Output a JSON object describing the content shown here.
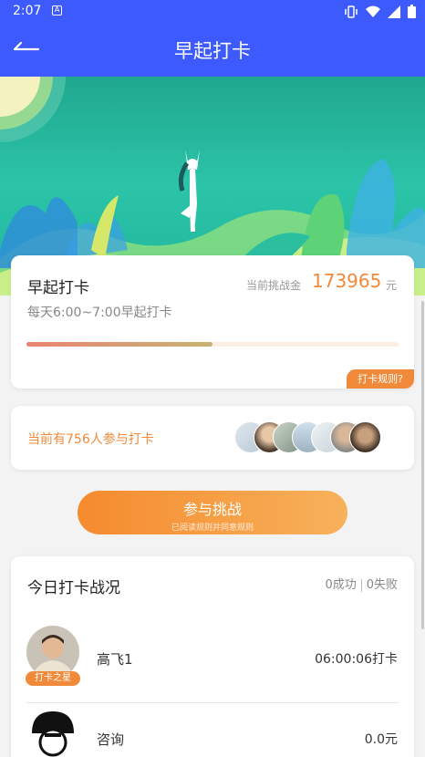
{
  "status_bar": {
    "time": "2:07",
    "icons": [
      "a-notification-icon",
      "vibrate-icon",
      "wifi-icon",
      "signal-icon",
      "battery-icon"
    ]
  },
  "app_bar": {
    "title": "早起打卡",
    "back_icon": "back-arrow-icon"
  },
  "colors": {
    "primary": "#3d5afe",
    "accent": "#f08a3a",
    "banner": "#2cc4a9"
  },
  "challenge": {
    "name": "早起打卡",
    "schedule": "每天6:00~7:00早起打卡",
    "pool_label": "当前挑战金",
    "pool_amount": "173965",
    "pool_unit": "元",
    "progress": 0.5,
    "rules_label": "打卡规则?"
  },
  "participants": {
    "text": "当前有756人参与打卡",
    "avatar_count": 7
  },
  "join": {
    "label": "参与挑战",
    "sub_label": "已阅读规则并同意规则"
  },
  "today": {
    "title": "今日打卡战况",
    "success": "0成功",
    "fail": "0失败",
    "rows": [
      {
        "name": "高飞1",
        "value": "06:00:06打卡",
        "badge": "打卡之星"
      },
      {
        "name": "咨询",
        "value": "0.0元"
      }
    ]
  }
}
